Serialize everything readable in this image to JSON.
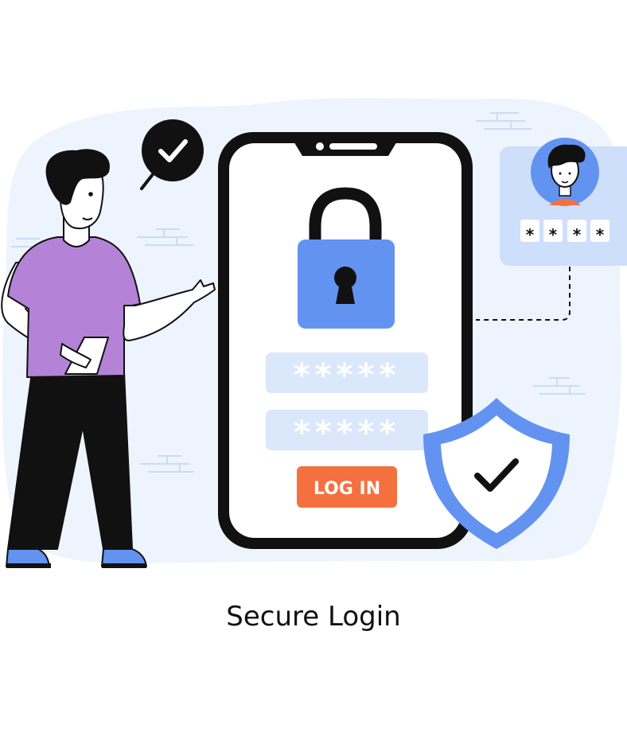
{
  "caption": "Secure Login",
  "login_button_label": "LOG IN",
  "password_fields": [
    {
      "mask": "*****"
    },
    {
      "mask": "*****"
    }
  ],
  "pin_digits": [
    "*",
    "*",
    "*",
    "*"
  ],
  "colors": {
    "background_blob": "#eef4fd",
    "primary_blue": "#6393f0",
    "light_blue": "#cddffb",
    "field_blue": "#dbe7fb",
    "button_orange": "#f5703f",
    "shirt_purple": "#b483d7",
    "outline": "#111111"
  },
  "icons": [
    "check-badge-icon",
    "padlock-icon",
    "shield-check-icon",
    "user-avatar-icon"
  ]
}
